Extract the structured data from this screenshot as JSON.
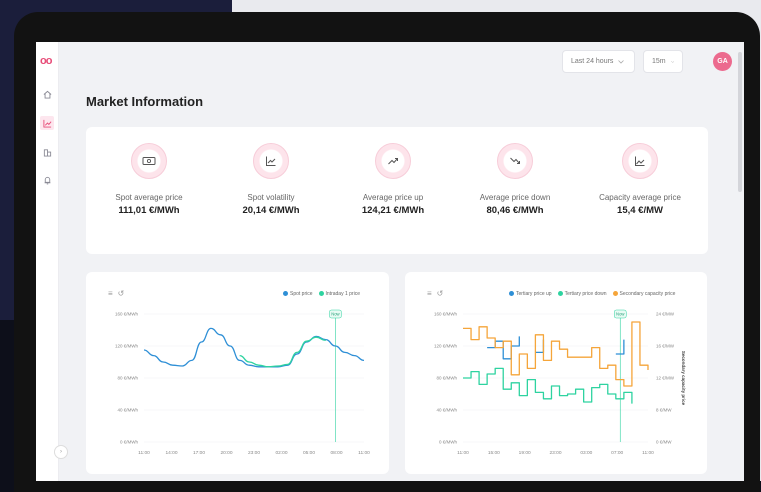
{
  "app": {
    "logo_text": "oo"
  },
  "sidebar": {
    "items": [
      {
        "name": "home",
        "icon": "home-icon"
      },
      {
        "name": "chart",
        "icon": "chart-line-icon",
        "active": true
      },
      {
        "name": "buildings",
        "icon": "buildings-icon"
      },
      {
        "name": "alerts",
        "icon": "bell-icon"
      }
    ]
  },
  "header": {
    "range_select": "Last 24 hours",
    "interval_select": "15m",
    "avatar_initials": "GA"
  },
  "page": {
    "title": "Market Information"
  },
  "metrics": [
    {
      "label": "Spot average price",
      "value": "111,01 €/MWh",
      "icon": "banknote-icon"
    },
    {
      "label": "Spot volatility",
      "value": "20,14 €/MWh",
      "icon": "chart-line-icon"
    },
    {
      "label": "Average price up",
      "value": "124,21 €/MWh",
      "icon": "trend-up-icon"
    },
    {
      "label": "Average price down",
      "value": "80,46 €/MWh",
      "icon": "trend-down-icon"
    },
    {
      "label": "Capacity average price",
      "value": "15,4 €/MW",
      "icon": "chart-area-icon"
    }
  ],
  "colors": {
    "accent": "#e74c78",
    "blue": "#2e8fd6",
    "green": "#2ed3a0",
    "orange": "#f5a53a"
  },
  "chart_data": [
    {
      "type": "line",
      "legend": [
        "Spot price",
        "Intraday 1 price"
      ],
      "x_ticks": [
        "11:00",
        "14:00",
        "17:00",
        "20:00",
        "23:00",
        "02:00",
        "05:00",
        "08:00",
        "11:00"
      ],
      "y_ticks": [
        "160 €/MWh",
        "120 €/MWh",
        "80 €/MWh",
        "40 €/MWh",
        "0 €/MWh"
      ],
      "ylim": [
        0,
        160
      ],
      "now_label": "Now",
      "x_count": 24,
      "series": [
        {
          "name": "Spot price",
          "color": "#2e8fd6",
          "values": [
            115,
            108,
            100,
            96,
            95,
            102,
            125,
            142,
            134,
            120,
            102,
            96,
            94,
            94,
            94,
            96,
            110,
            125,
            132,
            128,
            120,
            112,
            108,
            102
          ]
        },
        {
          "name": "Intraday 1 price",
          "color": "#2ed3a0",
          "start": 10,
          "values": [
            108,
            100,
            96,
            94,
            95,
            97,
            112,
            126,
            131,
            127
          ]
        }
      ]
    },
    {
      "type": "line",
      "legend": [
        "Tertiary price up",
        "Tertiary price down",
        "Secondary capacity price"
      ],
      "x_ticks": [
        "11:00",
        "15:00",
        "19:00",
        "23:00",
        "03:00",
        "07:00",
        "11:00"
      ],
      "y_ticks_left": [
        "160 €/MWh",
        "120 €/MWh",
        "80 €/MWh",
        "40 €/MWh",
        "0 €/MWh"
      ],
      "y_ticks_right": [
        "24 €/MW",
        "16 €/MW",
        "12 €/MW",
        "8 €/MW",
        "0 €/MW"
      ],
      "y_right_label": "Secondary capacity price",
      "ylim": [
        0,
        160
      ],
      "now_label": "Now",
      "x_count": 24,
      "series": [
        {
          "name": "Tertiary price up",
          "color": "#2e8fd6",
          "values": [
            null,
            null,
            null,
            118,
            126,
            104,
            120,
            132,
            null,
            112,
            128,
            null,
            null,
            null,
            null,
            null,
            null,
            null,
            null,
            110,
            128,
            null,
            null,
            null
          ]
        },
        {
          "name": "Tertiary price down",
          "color": "#2ed3a0",
          "values": [
            80,
            88,
            72,
            85,
            92,
            66,
            74,
            58,
            78,
            62,
            54,
            70,
            58,
            60,
            66,
            50,
            68,
            72,
            60,
            54,
            62,
            48,
            null,
            null
          ]
        },
        {
          "name": "Secondary capacity price",
          "color": "#f5a53a",
          "values": [
            142,
            128,
            144,
            130,
            118,
            126,
            84,
            110,
            92,
            134,
            102,
            126,
            116,
            106,
            106,
            106,
            118,
            92,
            96,
            78,
            70,
            150,
            96,
            90
          ]
        }
      ]
    }
  ]
}
